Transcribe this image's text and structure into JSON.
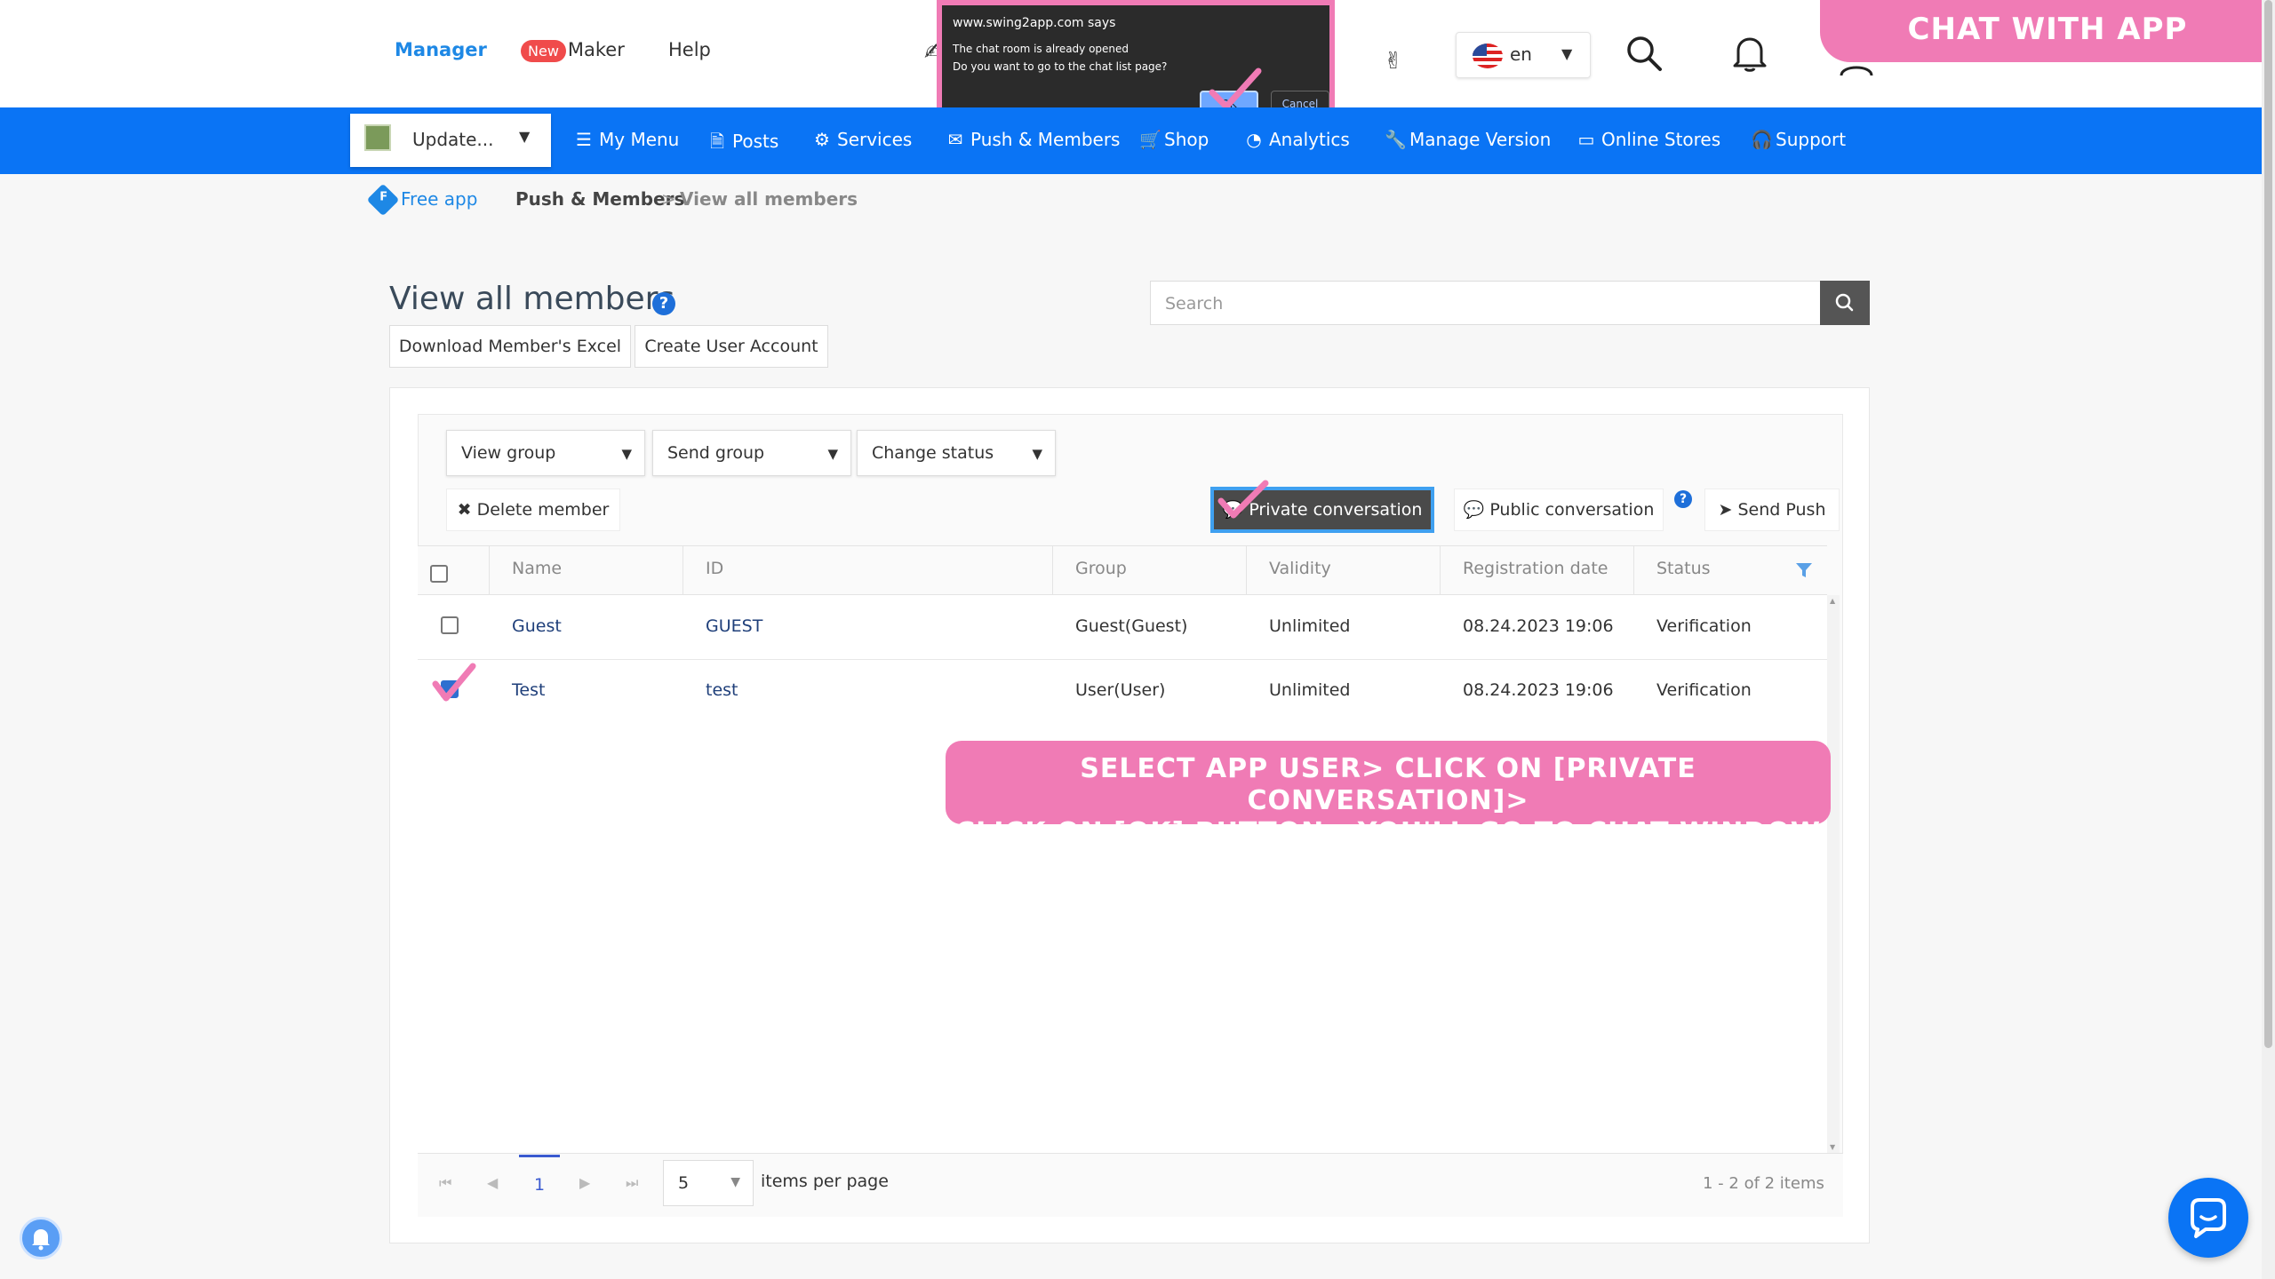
{
  "header": {
    "manager": "Manager",
    "new_badge": "New",
    "maker": "Maker",
    "help": "Help",
    "lang": "en",
    "chat_banner": "CHAT WITH APP MEMBERS"
  },
  "dialog": {
    "site": "www.swing2app.com says",
    "message_line1": "The chat room is already opened",
    "message_line2": "Do you want to go to the chat list page?",
    "ok": "OK",
    "cancel": "Cancel"
  },
  "nav": {
    "update_label": "Update...",
    "items": [
      "My Menu",
      "Posts",
      "Services",
      "Push & Members",
      "Shop",
      "Analytics",
      "Manage Version",
      "Online Stores",
      "Support"
    ]
  },
  "breadcrumb": {
    "free_badge": "F",
    "free": "Free app",
    "push": "Push & Members",
    "sep": ">",
    "current": "View all members"
  },
  "page": {
    "title": "View all members",
    "help": "?",
    "download": "Download Member's Excel",
    "create": "Create User Account",
    "search_placeholder": "Search"
  },
  "toolbar": {
    "view_group": "View group",
    "send_group": "Send group",
    "change_status": "Change status",
    "delete": "Delete member",
    "private": "Private conversation",
    "public": "Public conversation",
    "help": "?",
    "send_push": "Send Push"
  },
  "table": {
    "headers": [
      "Name",
      "ID",
      "Group",
      "Validity",
      "Registration date",
      "Status"
    ],
    "rows": [
      {
        "name": "Guest",
        "id": "GUEST",
        "group": "Guest(Guest)",
        "validity": "Unlimited",
        "date": "08.24.2023 19:06",
        "status": "Verification",
        "checked": false
      },
      {
        "name": "Test",
        "id": "test",
        "group": "User(User)",
        "validity": "Unlimited",
        "date": "08.24.2023 19:06",
        "status": "Verification",
        "checked": true
      }
    ]
  },
  "pager": {
    "current_page": "1",
    "per_page": "5",
    "per_page_label": "items per page",
    "range": "1 - 2 of 2 items"
  },
  "annotation": {
    "line1": "SELECT APP USER> CLICK ON [PRIVATE CONVERSATION]>",
    "line2": "CLICK ON [OK] BUTTON> YOU'LL GO TO CHAT WINDOW"
  },
  "colors": {
    "primary": "#0a74f5",
    "accent_pink": "#f07bb5",
    "new_badge": "#f04b4b"
  }
}
